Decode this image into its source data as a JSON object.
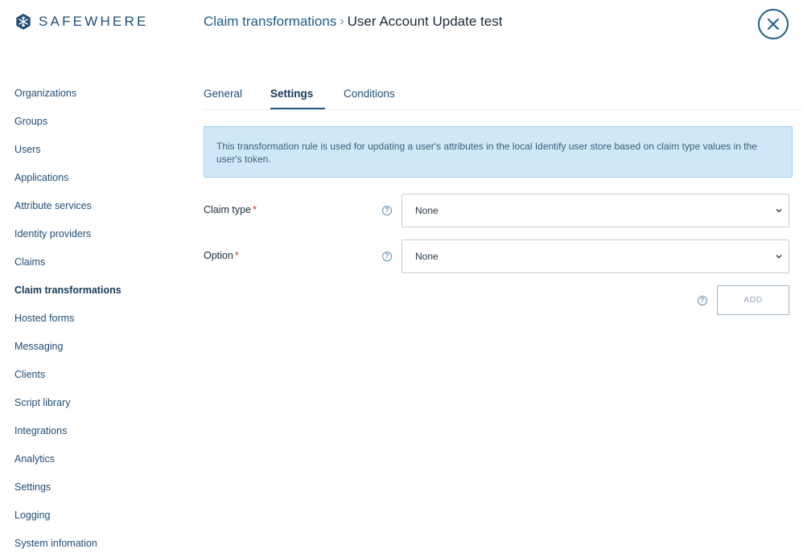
{
  "app": {
    "logo_text": "SAFEWHERE",
    "accent_color": "#1f5c8a"
  },
  "header": {
    "breadcrumb_parent": "Claim transformations",
    "breadcrumb_separator": "›",
    "breadcrumb_current": "User Account Update test",
    "close_icon": "close-icon"
  },
  "sidebar": {
    "items": [
      {
        "label": "Organizations"
      },
      {
        "label": "Groups"
      },
      {
        "label": "Users"
      },
      {
        "label": "Applications"
      },
      {
        "label": "Attribute services"
      },
      {
        "label": "Identity providers"
      },
      {
        "label": "Claims"
      },
      {
        "label": "Claim transformations",
        "active": true
      },
      {
        "label": "Hosted forms"
      },
      {
        "label": "Messaging"
      },
      {
        "label": "Clients"
      },
      {
        "label": "Script library"
      },
      {
        "label": "Integrations"
      },
      {
        "label": "Analytics"
      },
      {
        "label": "Settings"
      },
      {
        "label": "Logging"
      },
      {
        "label": "System infomation"
      }
    ]
  },
  "tabs": [
    {
      "label": "General"
    },
    {
      "label": "Settings",
      "active": true
    },
    {
      "label": "Conditions"
    }
  ],
  "info": {
    "text": "This transformation rule is used for updating a user's attributes in the local Identify user store based on claim type values in the user's token."
  },
  "form": {
    "claim_type": {
      "label": "Claim type",
      "required_mark": "*",
      "help": "?",
      "value": "None"
    },
    "option": {
      "label": "Option",
      "required_mark": "*",
      "help": "?",
      "value": "None"
    },
    "add": {
      "label": "ADD",
      "help": "?"
    }
  }
}
